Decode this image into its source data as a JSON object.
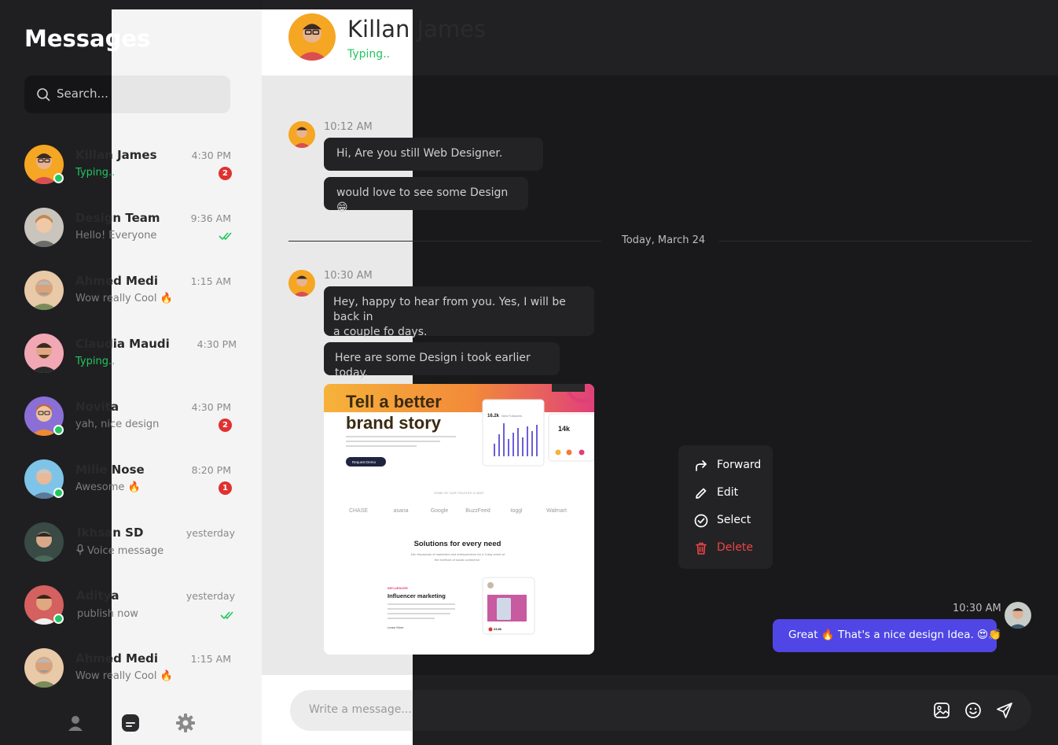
{
  "sidebar": {
    "title": "Messages",
    "search_placeholder": "Search...",
    "conversations": [
      {
        "name": "Killan James",
        "preview": "Typing..",
        "time": "4:30 PM",
        "unread": "2"
      },
      {
        "name": "Design Team",
        "preview": "Hello! Everyone",
        "time": "9:36 AM"
      },
      {
        "name": "Ahmed Medi",
        "preview": "Wow really Cool 🔥",
        "time": "1:15 AM"
      },
      {
        "name": "Claudia Maudi",
        "preview": "Typing..",
        "time": "4:30 PM"
      },
      {
        "name": "Novita",
        "preview": "yah, nice design",
        "time": "4:30 PM",
        "unread": "2"
      },
      {
        "name": "Milie Nose",
        "preview": "Awesome 🔥",
        "time": "8:20 PM",
        "unread": "1"
      },
      {
        "name": "Ikhsan SD",
        "preview": "Voice message",
        "time": "yesterday"
      },
      {
        "name": "Aditya",
        "preview": "publish now",
        "time": "yesterday"
      },
      {
        "name": "Ahmed Medi",
        "preview": "Wow really Cool 🔥",
        "time": "1:15 AM"
      }
    ],
    "nav": [
      "user-icon",
      "chat-icon",
      "gear-icon"
    ]
  },
  "chat": {
    "contact_name": "Killan James",
    "contact_status": "Typing..",
    "messages": [
      {
        "time": "10:12 AM",
        "bubbles": [
          "Hi, Are you still Web Designer.",
          "would love to see some Design 😁"
        ]
      },
      {
        "time": "10:30 AM",
        "bubbles": [
          "Hey, happy to hear from you. Yes, I will be back in",
          "a couple fo days.",
          "Here are some Design i took earlier today."
        ]
      }
    ],
    "date_divider": "Today, March 24",
    "my_message": {
      "time": "10:30 AM",
      "text": "Great 🔥  That's a nice design Idea. 😍👏"
    },
    "composer_placeholder": "Write a message..."
  },
  "shared_image": {
    "headline_1": "Tell a better",
    "headline_2": "brand story",
    "stat_followers": "16.2k",
    "stat_label": "New Followers",
    "card_value": "14k",
    "cta": "Request Demo",
    "trusted_label": "SOME OF OUR TRUSTED CLIENT",
    "logos": [
      "CHASE",
      "asana",
      "Google",
      "BuzzFeed",
      "toggl",
      "Walmart"
    ],
    "section_title": "Solutions for every need",
    "section_sub_1": "Join thousands of marketers and entrepreneurs for a 3-day event at",
    "section_sub_2": "the forefront of social commerce.",
    "tag": "INFLUENCER",
    "feature_title": "Influencer marketing",
    "feature_link": "Learn More",
    "likes": "23.8k"
  },
  "context_menu": {
    "items": [
      {
        "label": "Forward",
        "icon": "forward-icon"
      },
      {
        "label": "Edit",
        "icon": "pencil-icon"
      },
      {
        "label": "Select",
        "icon": "check-circle-icon"
      },
      {
        "label": "Delete",
        "icon": "trash-icon",
        "color": "#ef4444"
      }
    ]
  },
  "colors": {
    "accent": "#4f46e5",
    "online": "#22c55e",
    "badge": "#e03131",
    "danger": "#ef4444"
  }
}
